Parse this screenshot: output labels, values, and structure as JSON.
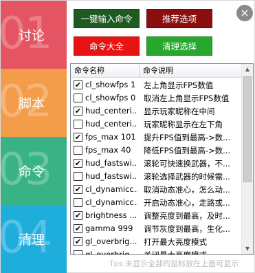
{
  "sidebar": {
    "items": [
      {
        "num": "01",
        "label": "讨论",
        "color": "#e55462"
      },
      {
        "num": "02",
        "label": "脚本",
        "color": "#f39c49"
      },
      {
        "num": "03",
        "label": "命令",
        "color": "#39b386"
      },
      {
        "num": "04",
        "label": "清理",
        "color": "#1faedc"
      }
    ]
  },
  "close_icon": "×",
  "buttons": {
    "one_click": {
      "label": "一键输入命令",
      "color": "#1e5a22"
    },
    "recommend": {
      "label": "推荐选项",
      "color": "#8c0f0f"
    },
    "all_commands": {
      "label": "命令大全",
      "color": "#e81414"
    },
    "clear": {
      "label": "清理选择",
      "color": "#27a82d"
    }
  },
  "list": {
    "columns": [
      "命令名称",
      "命令说明"
    ],
    "rows": [
      {
        "checked": true,
        "name": "cl_showfps 1",
        "desc": "左上角显示FPS数值"
      },
      {
        "checked": false,
        "name": "cl_showfps 0",
        "desc": "取消左上角显示FPS数值"
      },
      {
        "checked": true,
        "name": "hud_centeri...",
        "desc": "显示玩家昵称在中间"
      },
      {
        "checked": false,
        "name": "hud_centeri...",
        "desc": "玩家昵称显示在左下角"
      },
      {
        "checked": true,
        "name": "fps_max 101",
        "desc": "提升FPS值到最高->数..."
      },
      {
        "checked": false,
        "name": "fps_max 40",
        "desc": "降低FPS值到最高->数..."
      },
      {
        "checked": true,
        "name": "hud_fastswi...",
        "desc": "滚轮可快速换武器，不..."
      },
      {
        "checked": false,
        "name": "hud_fastswi...",
        "desc": "滚轮选择武器的时候需..."
      },
      {
        "checked": true,
        "name": "cl_dynamicc...",
        "desc": "取消动态准心，怎么动..."
      },
      {
        "checked": false,
        "name": "cl_dynamicc...",
        "desc": "开启动态准心，走路或..."
      },
      {
        "checked": true,
        "name": "brightness ...",
        "desc": "调整亮度到最高，及时..."
      },
      {
        "checked": true,
        "name": "gamma 999",
        "desc": "调节灰度到最高，生化..."
      },
      {
        "checked": true,
        "name": "gl_overbrig...",
        "desc": "打开最大亮度模式"
      },
      {
        "checked": false,
        "name": "gl_overbrig...",
        "desc": "关闭最大亮度模式"
      }
    ]
  },
  "tip": "Tps:未显示全部的鼠标放在上面可显示"
}
